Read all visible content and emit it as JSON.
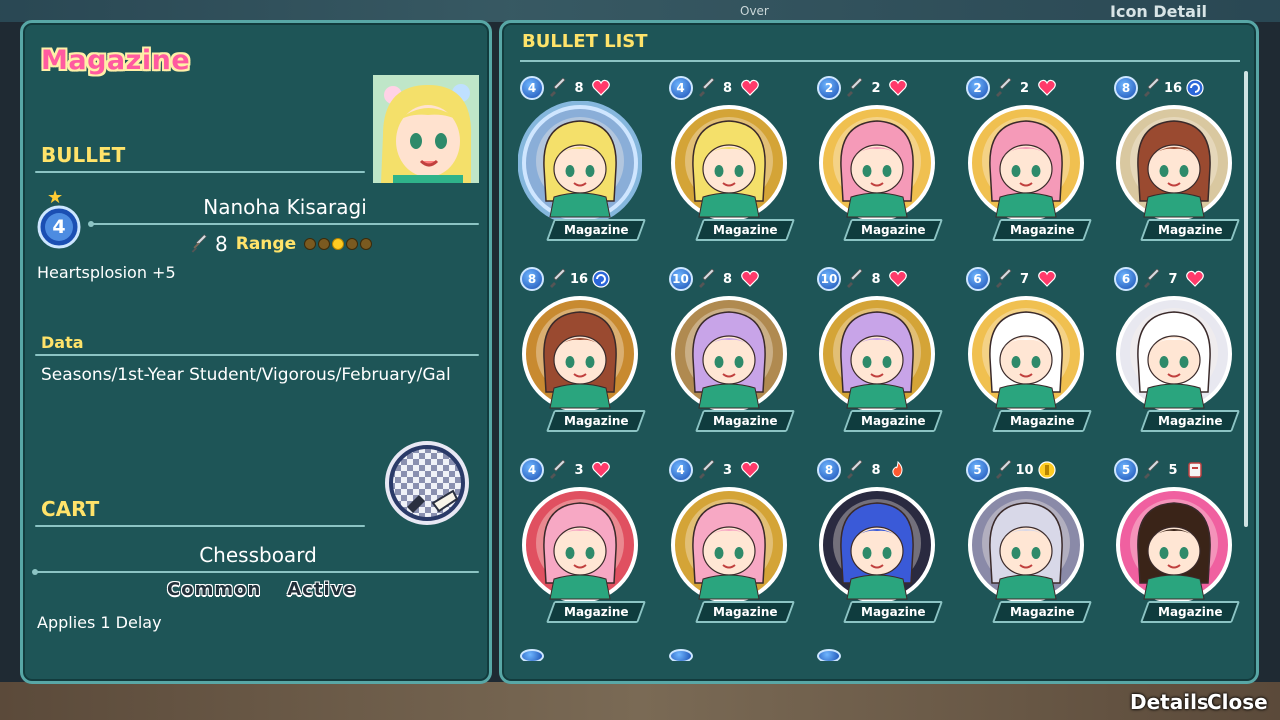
{
  "background": {
    "top_hint": "Over",
    "right_hint": "Icon Detail"
  },
  "left_panel": {
    "title": "Magazine",
    "bullet_section_label": "BULLET",
    "bullet": {
      "name": "Nanoha Kisaragi",
      "level": "4",
      "stars": 1,
      "attack": "8",
      "range_label": "Range",
      "range_level": 3,
      "range_max": 5,
      "skill": "Heartsplosion +5"
    },
    "data_section_label": "Data",
    "data_text": "Seasons/1st-Year Student/Vigorous/February/Gal",
    "cart_section_label": "CART",
    "cart": {
      "name": "Chessboard",
      "tags": [
        "Common",
        "Active"
      ],
      "effect": "Applies 1 Delay"
    }
  },
  "right_panel": {
    "title": "BULLET LIST",
    "cards": [
      {
        "level": "4",
        "attack": "8",
        "trait": "heart",
        "tag": "Magazine",
        "hair": "#f4e06a",
        "ring": "#8aaed8",
        "selected": true
      },
      {
        "level": "4",
        "attack": "8",
        "trait": "heart",
        "tag": "Magazine",
        "hair": "#f4e06a",
        "ring": "#d4a437",
        "selected": false
      },
      {
        "level": "2",
        "attack": "2",
        "trait": "heart",
        "tag": "Magazine",
        "hair": "#f59ab8",
        "ring": "#f0c050",
        "selected": false
      },
      {
        "level": "2",
        "attack": "2",
        "trait": "heart",
        "tag": "Magazine",
        "hair": "#f59ab8",
        "ring": "#f0c050",
        "selected": false
      },
      {
        "level": "8",
        "attack": "16",
        "trait": "cycle",
        "tag": "Magazine",
        "hair": "#9a4a30",
        "ring": "#d9c8a0",
        "selected": false
      },
      {
        "level": "8",
        "attack": "16",
        "trait": "cycle",
        "tag": "Magazine",
        "hair": "#9a4a30",
        "ring": "#c88a30",
        "selected": false
      },
      {
        "level": "10",
        "attack": "8",
        "trait": "heart",
        "tag": "Magazine",
        "hair": "#c8a4e8",
        "ring": "#b08a50",
        "selected": false
      },
      {
        "level": "10",
        "attack": "8",
        "trait": "heart",
        "tag": "Magazine",
        "hair": "#c8a4e8",
        "ring": "#d4a437",
        "selected": false
      },
      {
        "level": "6",
        "attack": "7",
        "trait": "heart",
        "tag": "Magazine",
        "hair": "#ffffff",
        "ring": "#f0c050",
        "selected": false
      },
      {
        "level": "6",
        "attack": "7",
        "trait": "heart",
        "tag": "Magazine",
        "hair": "#ffffff",
        "ring": "#e8e8f0",
        "selected": false
      },
      {
        "level": "4",
        "attack": "3",
        "trait": "heart",
        "tag": "Magazine",
        "hair": "#f7a8c4",
        "ring": "#e05060",
        "selected": false
      },
      {
        "level": "4",
        "attack": "3",
        "trait": "heart",
        "tag": "Magazine",
        "hair": "#f7a8c4",
        "ring": "#d4a437",
        "selected": false
      },
      {
        "level": "8",
        "attack": "8",
        "trait": "flame",
        "tag": "Magazine",
        "hair": "#3a5ad8",
        "ring": "#2a2a40",
        "selected": false
      },
      {
        "level": "5",
        "attack": "10",
        "trait": "coin",
        "tag": "Magazine",
        "hair": "#d8d8e8",
        "ring": "#8a8aa8",
        "selected": false
      },
      {
        "level": "5",
        "attack": "5",
        "trait": "cup",
        "tag": "Magazine",
        "hair": "#3a2418",
        "ring": "#f060a0",
        "selected": false
      }
    ]
  },
  "footer": {
    "details_label": "Details",
    "close_label": "Close"
  },
  "colors": {
    "panel_bg": "#1e5557",
    "panel_border": "#58a7a6",
    "section_label": "#ffe36a",
    "title_pink": "#ff5aa0"
  }
}
